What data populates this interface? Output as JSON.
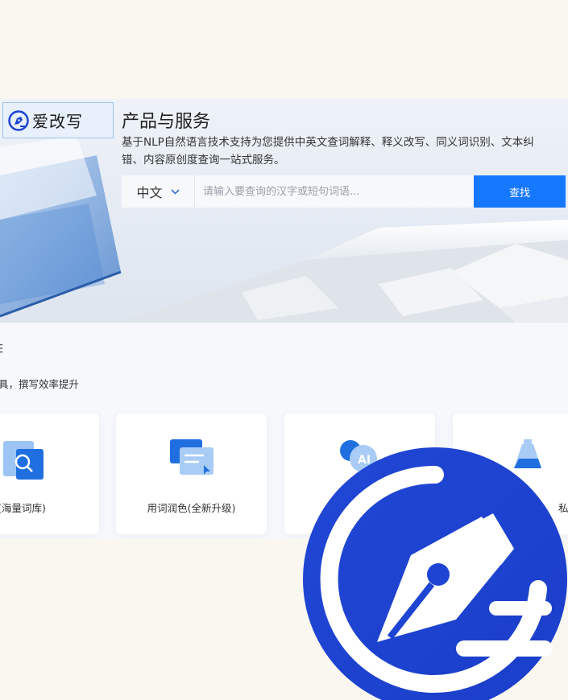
{
  "logo": {
    "text": "爱改写",
    "icon": "pen-nib-icon"
  },
  "hero": {
    "title": "产品与服务",
    "desc_line1": "基于NLP自然语言技术支持为您提供中英文查词解释、释义改写、同义词识别、文本纠",
    "desc_line2": "错、内容原创度查询一站式服务。"
  },
  "search": {
    "lang": "中文",
    "placeholder": "请输入要查询的汉字或短句词语...",
    "button": "查找"
  },
  "section": {
    "title": "E",
    "subtitle": "具，撰写效率提升"
  },
  "cards": [
    {
      "label": "释义(海量词库)",
      "icon": "magnifier-doc-icon"
    },
    {
      "label": "用词润色(全新升级)",
      "icon": "text-edit-icon"
    },
    {
      "label": "",
      "icon": "ai-bubble-icon"
    },
    {
      "label": "私信",
      "icon": "flask-icon"
    }
  ],
  "colors": {
    "accent": "#1677ff",
    "logo_blue": "#1d44d2"
  }
}
